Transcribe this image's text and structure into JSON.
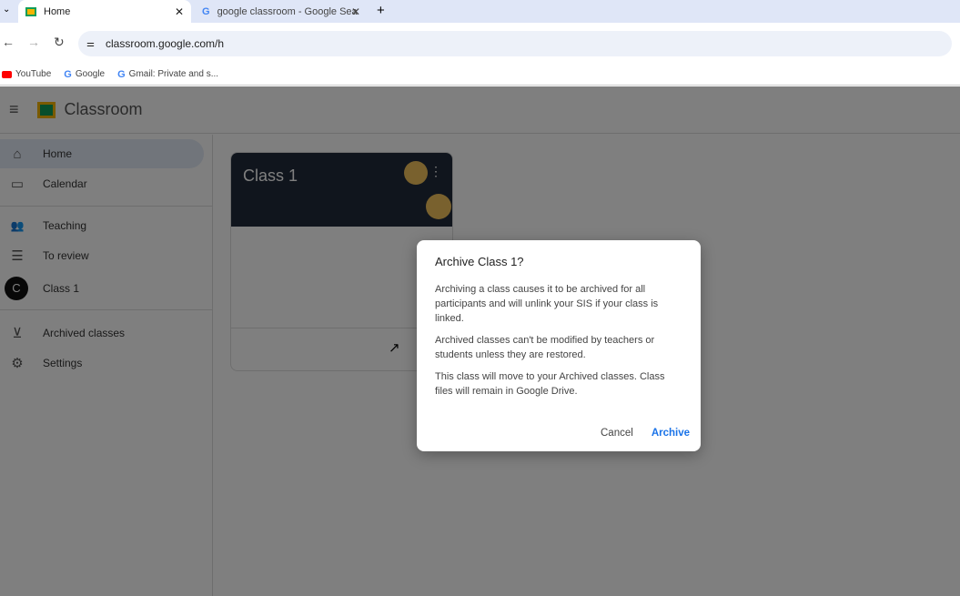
{
  "browser": {
    "tabs": [
      {
        "title": "Home",
        "active": true
      },
      {
        "title": "google classroom - Google Sea",
        "active": false
      }
    ],
    "url": "classroom.google.com/h",
    "bookmarks": [
      "YouTube",
      "Google",
      "Gmail: Private and s..."
    ]
  },
  "app": {
    "title": "Classroom",
    "sidebar": [
      {
        "label": "Home",
        "icon": "home-icon",
        "glyph": "⌂"
      },
      {
        "label": "Calendar",
        "icon": "calendar-icon",
        "glyph": "▭"
      },
      {
        "label": "Teaching",
        "icon": "people-icon",
        "glyph": "👥"
      },
      {
        "label": "To review",
        "icon": "review-icon",
        "glyph": "☰"
      },
      {
        "label": "Class 1",
        "icon": "class-avatar",
        "glyph": "C"
      },
      {
        "label": "Archived classes",
        "icon": "archive-icon",
        "glyph": "⊻"
      },
      {
        "label": "Settings",
        "icon": "gear-icon",
        "glyph": "⚙"
      }
    ],
    "card": {
      "title": "Class 1"
    }
  },
  "dialog": {
    "title": "Archive Class 1?",
    "paragraphs": [
      "Archiving a class causes it to be archived for all participants and will unlink your SIS if your class is linked.",
      "Archived classes can't be modified by teachers or students unless they are restored.",
      "This class will move to your Archived classes. Class files will remain in Google Drive."
    ],
    "cancel": "Cancel",
    "confirm": "Archive"
  },
  "colors": {
    "accent": "#1a73e8",
    "overlay": "rgba(0,0,0,0.5)"
  }
}
